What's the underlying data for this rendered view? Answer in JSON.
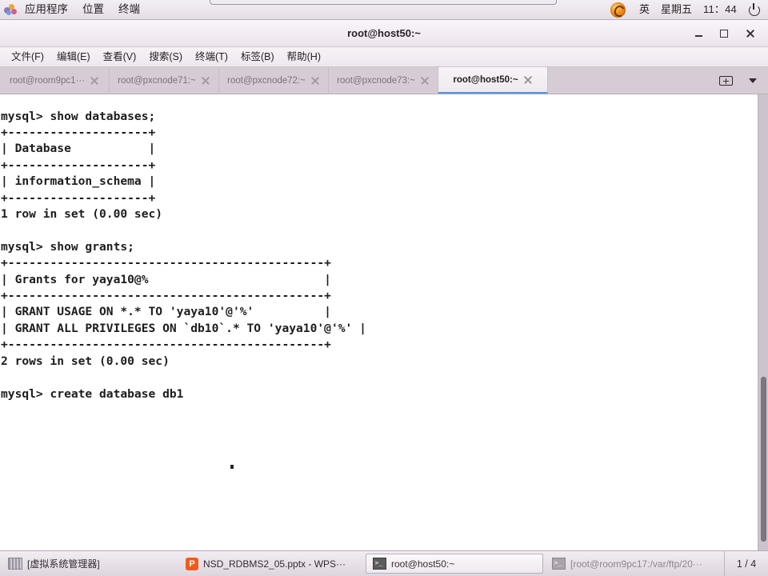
{
  "top_panel": {
    "menus": [
      "应用程序",
      "位置",
      "终端"
    ],
    "apps_icon": "applications-icon",
    "firefox_icon": "firefox-icon",
    "input_method": "英",
    "weekday": "星期五",
    "clock": "11：44",
    "power_icon": "power-icon"
  },
  "window": {
    "title": "root@host50:~",
    "minimize_icon": "minimize-icon",
    "maximize_icon": "maximize-icon",
    "close_icon": "close-icon"
  },
  "menubar": {
    "items": [
      "文件(F)",
      "编辑(E)",
      "查看(V)",
      "搜索(S)",
      "终端(T)",
      "标签(B)",
      "帮助(H)"
    ]
  },
  "tabbar": {
    "tabs": [
      {
        "label": "root@room9pc1···",
        "active": false
      },
      {
        "label": "root@pxcnode71:~",
        "active": false
      },
      {
        "label": "root@pxcnode72:~",
        "active": false
      },
      {
        "label": "root@pxcnode73:~",
        "active": false
      },
      {
        "label": "root@host50:~",
        "active": true
      }
    ],
    "new_tab_icon": "new-tab-icon",
    "dropdown_icon": "chevron-down-icon"
  },
  "terminal": {
    "content": "mysql> show databases;\n+--------------------+\n| Database           |\n+--------------------+\n| information_schema |\n+--------------------+\n1 row in set (0.00 sec)\n\nmysql> show grants;\n+---------------------------------------------+\n| Grants for yaya10@%                         |\n+---------------------------------------------+\n| GRANT USAGE ON *.* TO 'yaya10'@'%'          |\n| GRANT ALL PRIVILEGES ON `db10`.* TO 'yaya10'@'%' |\n+---------------------------------------------+\n2 rows in set (0.00 sec)\n\nmysql> create database db1",
    "scrollbar": "vertical-scrollbar"
  },
  "taskbar": {
    "items": [
      {
        "label": "[虚拟系统管理器]",
        "icon": "vm-manager-icon",
        "state": "normal"
      },
      {
        "label": "NSD_RDBMS2_05.pptx - WPS···",
        "icon": "wps-icon",
        "state": "normal"
      },
      {
        "label": "root@host50:~",
        "icon": "terminal-icon",
        "state": "active"
      },
      {
        "label": "[root@room9pc17:/var/ftp/20···",
        "icon": "terminal-icon",
        "state": "dim"
      }
    ],
    "workspace": "1 / 4"
  },
  "colors": {
    "panel_bg": "#ece6ec",
    "tab_active_underline": "#5294d6",
    "terminal_bg": "#ffffff",
    "terminal_fg": "#1d1d1d",
    "wps_accent": "#f25c19"
  }
}
